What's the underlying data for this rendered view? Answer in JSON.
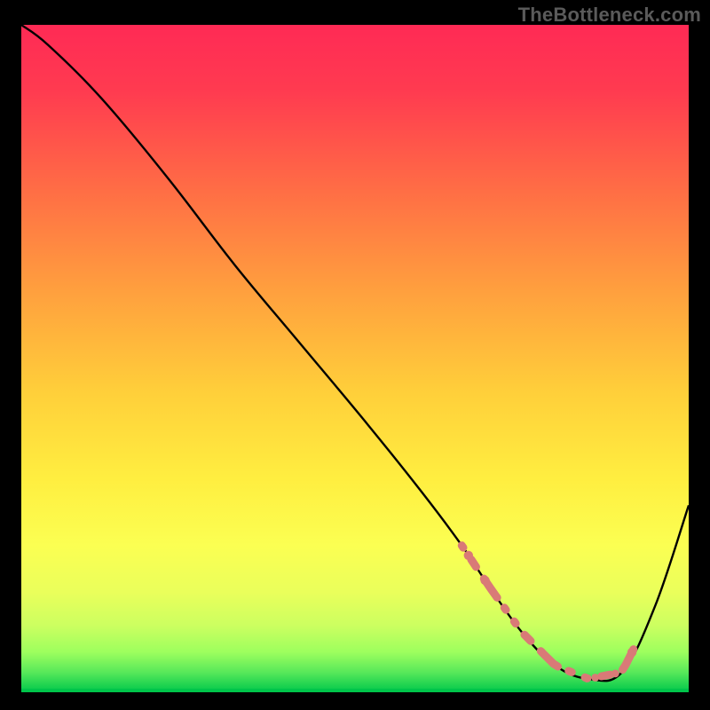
{
  "watermark": "TheBottleneck.com",
  "chart_data": {
    "type": "line",
    "title": "",
    "xlabel": "",
    "ylabel": "",
    "xlim": [
      0,
      100
    ],
    "ylim": [
      0,
      100
    ],
    "grid": false,
    "legend": false,
    "series": [
      {
        "name": "bottleneck-curve",
        "x": [
          0,
          4,
          12,
          22,
          32,
          42,
          52,
          60,
          66,
          70,
          75,
          80,
          85,
          90,
          95,
          100
        ],
        "y": [
          100,
          97,
          89,
          77,
          64,
          52,
          40,
          30,
          22,
          16,
          9,
          4,
          2,
          3,
          13,
          28
        ]
      }
    ],
    "highlight_band": {
      "comment": "dashed/dotted salmon segment near the trough",
      "x_range": [
        66,
        92
      ],
      "style": "dotted",
      "color": "#d97a77"
    },
    "optimal_band_y": [
      0,
      4
    ],
    "background_gradient": {
      "top": "#ff2a55",
      "mid_upper": "#ff8a3d",
      "mid": "#ffd93d",
      "mid_lower": "#f8ff5a",
      "lower": "#d8ff66",
      "bottom": "#00c84b"
    }
  }
}
